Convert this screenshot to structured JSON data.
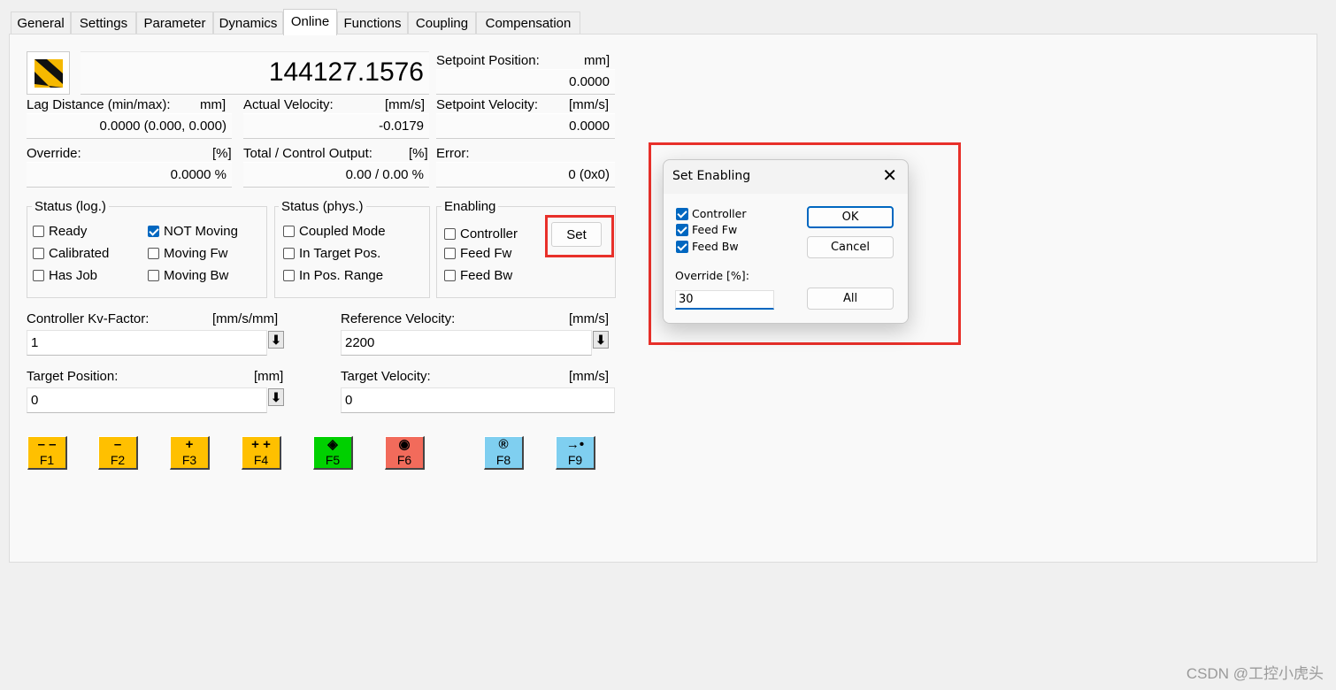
{
  "tabs": [
    "General",
    "Settings",
    "Parameter",
    "Dynamics",
    "Online",
    "Functions",
    "Coupling",
    "Compensation"
  ],
  "active_tab": "Online",
  "online": {
    "main_position": "144127.1576",
    "setpoint_position": {
      "label": "Setpoint Position:",
      "unit": "mm]",
      "value": "0.0000"
    },
    "lag_distance": {
      "label": "Lag Distance (min/max):",
      "unit": "mm]",
      "value": "0.0000  (0.000, 0.000)"
    },
    "actual_velocity": {
      "label": "Actual Velocity:",
      "unit": "[mm/s]",
      "value": "-0.0179"
    },
    "setpoint_velocity": {
      "label": "Setpoint Velocity:",
      "unit": "[mm/s]",
      "value": "0.0000"
    },
    "override": {
      "label": "Override:",
      "unit": "[%]",
      "value": "0.0000 %"
    },
    "total_output": {
      "label": "Total / Control Output:",
      "unit": "[%]",
      "value": "0.00 /  0.00 %"
    },
    "error": {
      "label": "Error:",
      "value": "0 (0x0)"
    }
  },
  "status_log": {
    "title": "Status (log.)",
    "items": [
      {
        "label": "Ready",
        "checked": false
      },
      {
        "label": "Calibrated",
        "checked": false
      },
      {
        "label": "Has Job",
        "checked": false
      },
      {
        "label": "NOT Moving",
        "checked": true
      },
      {
        "label": "Moving Fw",
        "checked": false
      },
      {
        "label": "Moving Bw",
        "checked": false
      }
    ]
  },
  "status_phys": {
    "title": "Status (phys.)",
    "items": [
      {
        "label": "Coupled Mode",
        "checked": false
      },
      {
        "label": "In Target Pos.",
        "checked": false
      },
      {
        "label": "In Pos. Range",
        "checked": false
      }
    ]
  },
  "enabling": {
    "title": "Enabling",
    "set_label": "Set",
    "items": [
      {
        "label": "Controller",
        "checked": false
      },
      {
        "label": "Feed Fw",
        "checked": false
      },
      {
        "label": "Feed Bw",
        "checked": false
      }
    ]
  },
  "inputs": {
    "kv_factor": {
      "label": "Controller Kv-Factor:",
      "unit": "[mm/s/mm]",
      "value": "1"
    },
    "ref_velocity": {
      "label": "Reference Velocity:",
      "unit": "[mm/s]",
      "value": "2200"
    },
    "target_position": {
      "label": "Target Position:",
      "unit": "[mm]",
      "value": "0"
    },
    "target_velocity": {
      "label": "Target Velocity:",
      "unit": "[mm/s]",
      "value": "0"
    },
    "arrow_glyph": "⬇"
  },
  "function_keys": [
    {
      "name": "F1",
      "symbol": "– –",
      "color": "#ffc000"
    },
    {
      "name": "F2",
      "symbol": "–",
      "color": "#ffc000"
    },
    {
      "name": "F3",
      "symbol": "+",
      "color": "#ffc000"
    },
    {
      "name": "F4",
      "symbol": "+ +",
      "color": "#ffc000"
    },
    {
      "name": "F5",
      "symbol": "◈",
      "color": "#00d000"
    },
    {
      "name": "F6",
      "symbol": "◉",
      "color": "#f26b5b"
    },
    {
      "name": "F8",
      "symbol": "®",
      "color": "#7fcff0"
    },
    {
      "name": "F9",
      "symbol": "→•",
      "color": "#7fcff0"
    }
  ],
  "dialog": {
    "title": "Set Enabling",
    "close_glyph": "✕",
    "items": [
      {
        "label": "Controller",
        "checked": true
      },
      {
        "label": "Feed Fw",
        "checked": true
      },
      {
        "label": "Feed Bw",
        "checked": true
      }
    ],
    "override_label": "Override [%]:",
    "override_value": "30",
    "ok_label": "OK",
    "cancel_label": "Cancel",
    "all_label": "All"
  },
  "watermark": "CSDN @工控小虎头",
  "colors": {
    "accent": "#0067c0",
    "highlight": "#e8302a"
  }
}
